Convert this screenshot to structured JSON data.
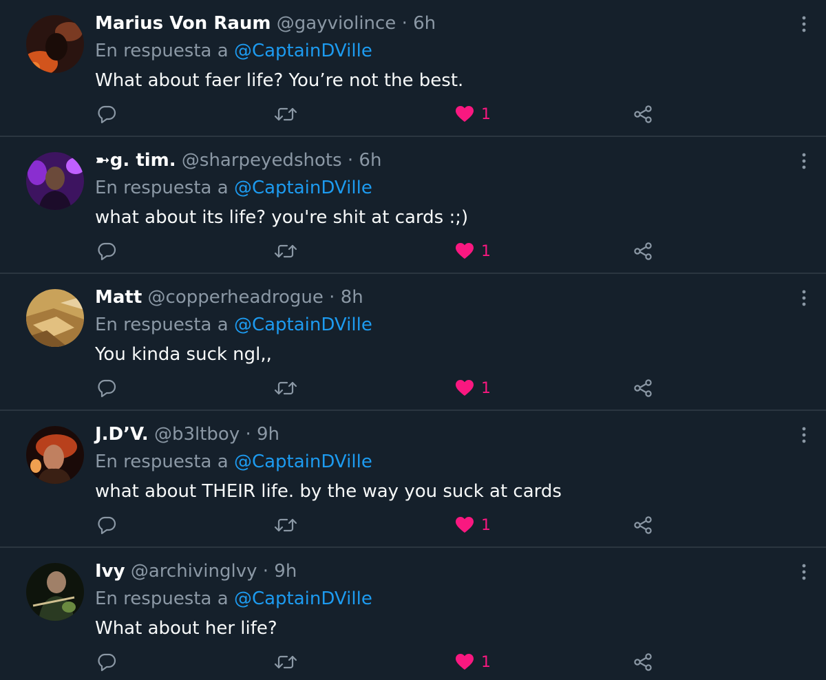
{
  "reply_prefix": "En respuesta a",
  "colors": {
    "background": "#15202b",
    "secondary_text": "#8b98a5",
    "mention": "#1d9bf0",
    "like": "#f91880"
  },
  "icons": {
    "reply": "reply-icon",
    "retweet": "retweet-icon",
    "like": "heart-icon",
    "share": "share-icon",
    "more": "more-options-icon"
  },
  "tweets": [
    {
      "name": "Marius Von Raum",
      "handle": "@gayviolince",
      "separator": "·",
      "time": "6h",
      "reply_to": "@CaptainDVille",
      "text": "What about faer life? You’re not the best.",
      "likes": "1"
    },
    {
      "name": "➼g. tim.",
      "handle": "@sharpeyedshots",
      "separator": "·",
      "time": "6h",
      "reply_to": "@CaptainDVille",
      "text": "what about its life? you're shit at cards :;)",
      "likes": "1"
    },
    {
      "name": "Matt",
      "handle": "@copperheadrogue",
      "separator": "·",
      "time": "8h",
      "reply_to": "@CaptainDVille",
      "text": "You kinda suck ngl,,",
      "likes": "1"
    },
    {
      "name": "J.D’V.",
      "handle": "@b3ltboy",
      "separator": "·",
      "time": "9h",
      "reply_to": "@CaptainDVille",
      "text": "what about THEIR life. by the way you suck at cards",
      "likes": "1"
    },
    {
      "name": "Ivy",
      "handle": "@archivinglvy",
      "separator": "·",
      "time": "9h",
      "reply_to": "@CaptainDVille",
      "text": "What about her life?",
      "likes": "1"
    }
  ]
}
